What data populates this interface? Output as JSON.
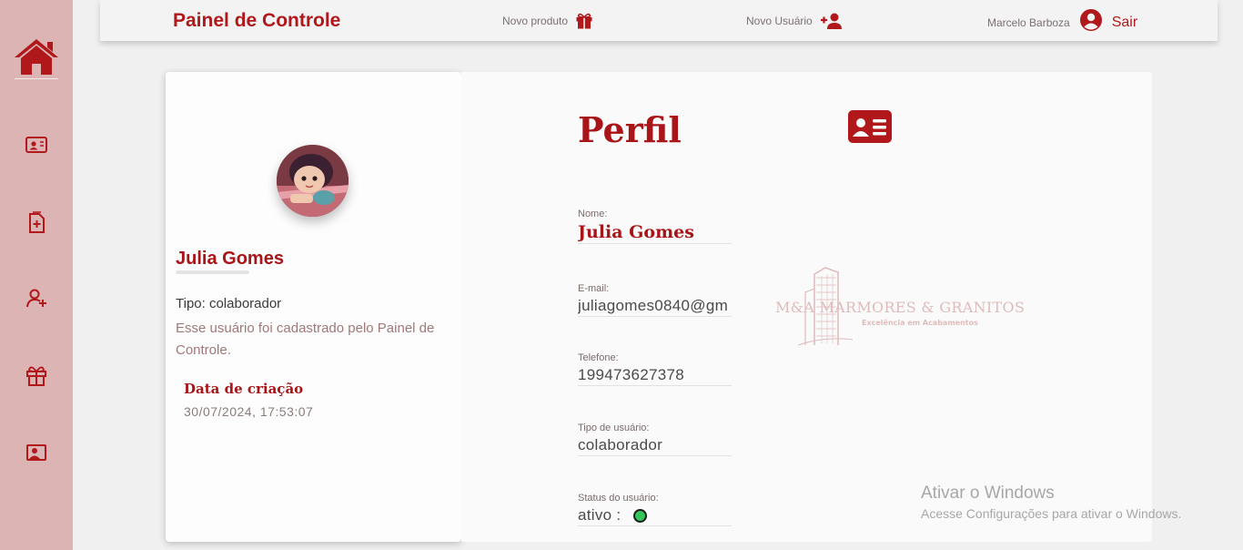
{
  "header": {
    "title": "Painel de Controle",
    "new_product": "Novo produto",
    "new_user": "Novo Usuário",
    "user_name": "Marcelo Barboza",
    "logout": "Sair"
  },
  "sidebar": {
    "items": [
      {
        "icon": "home-icon"
      },
      {
        "icon": "contact-card-icon"
      },
      {
        "icon": "document-add-icon"
      },
      {
        "icon": "user-add-icon"
      },
      {
        "icon": "gift-icon"
      },
      {
        "icon": "user-card-icon"
      }
    ]
  },
  "profile_card": {
    "name": "Julia Gomes",
    "type_line": "Tipo: colaborador",
    "description": "Esse usuário foi cadastrado pelo Painel de Controle.",
    "created_label": "Data de criação",
    "created_value": "30/07/2024, 17:53:07"
  },
  "details": {
    "title": "Perfil",
    "fields": [
      {
        "label": "Nome:",
        "value": "Julia Gomes"
      },
      {
        "label": "E-mail:",
        "value": "juliagomes0840@gm"
      },
      {
        "label": "Telefone:",
        "value": "199473627378"
      },
      {
        "label": "Tipo de usuário:",
        "value": "colaborador"
      },
      {
        "label": "Status do usuário:",
        "value": "ativo :"
      }
    ],
    "status_color": "#35c45a"
  },
  "watermark": {
    "name": "M&A MARMORES & GRANITOS",
    "tagline": "Excelência em Acabamentos"
  },
  "windows_notice": {
    "title": "Ativar o Windows",
    "subtitle": "Acesse Configurações para ativar o Windows."
  },
  "colors": {
    "accent": "#b0181c",
    "sidebar": "#dcb4b4",
    "background": "#f0f0f0"
  }
}
